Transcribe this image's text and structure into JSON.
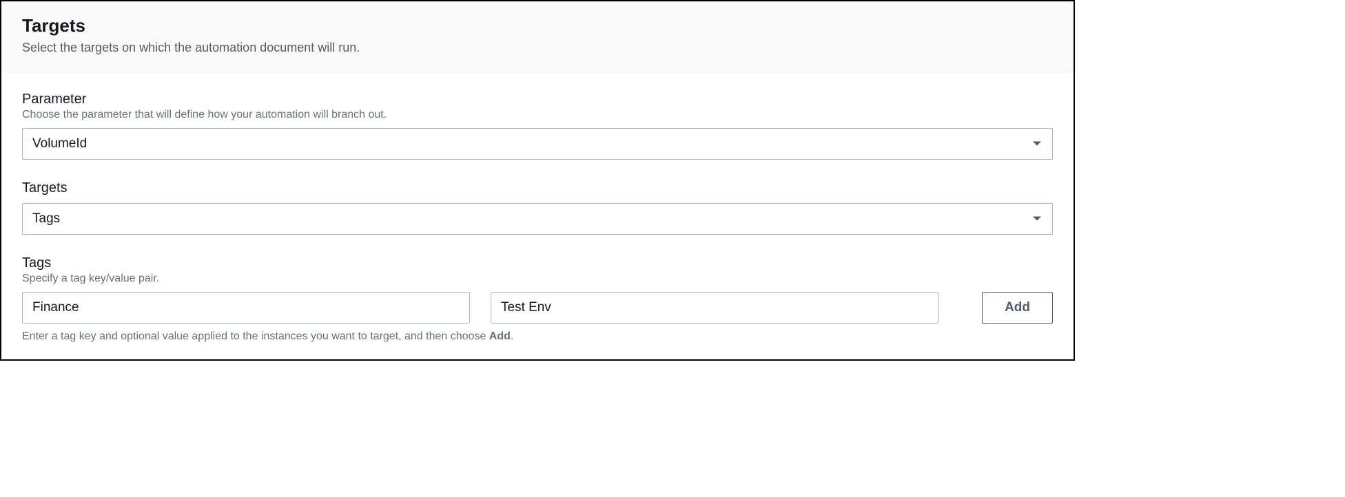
{
  "header": {
    "title": "Targets",
    "subtitle": "Select the targets on which the automation document will run."
  },
  "parameter": {
    "label": "Parameter",
    "description": "Choose the parameter that will define how your automation will branch out.",
    "selected": "VolumeId"
  },
  "targets": {
    "label": "Targets",
    "selected": "Tags"
  },
  "tags": {
    "label": "Tags",
    "description": "Specify a tag key/value pair.",
    "key_value": "Finance",
    "value_value": "Test Env",
    "add_label": "Add",
    "helper_prefix": "Enter a tag key and optional value applied to the instances you want to target, and then choose ",
    "helper_bold": "Add",
    "helper_suffix": "."
  }
}
